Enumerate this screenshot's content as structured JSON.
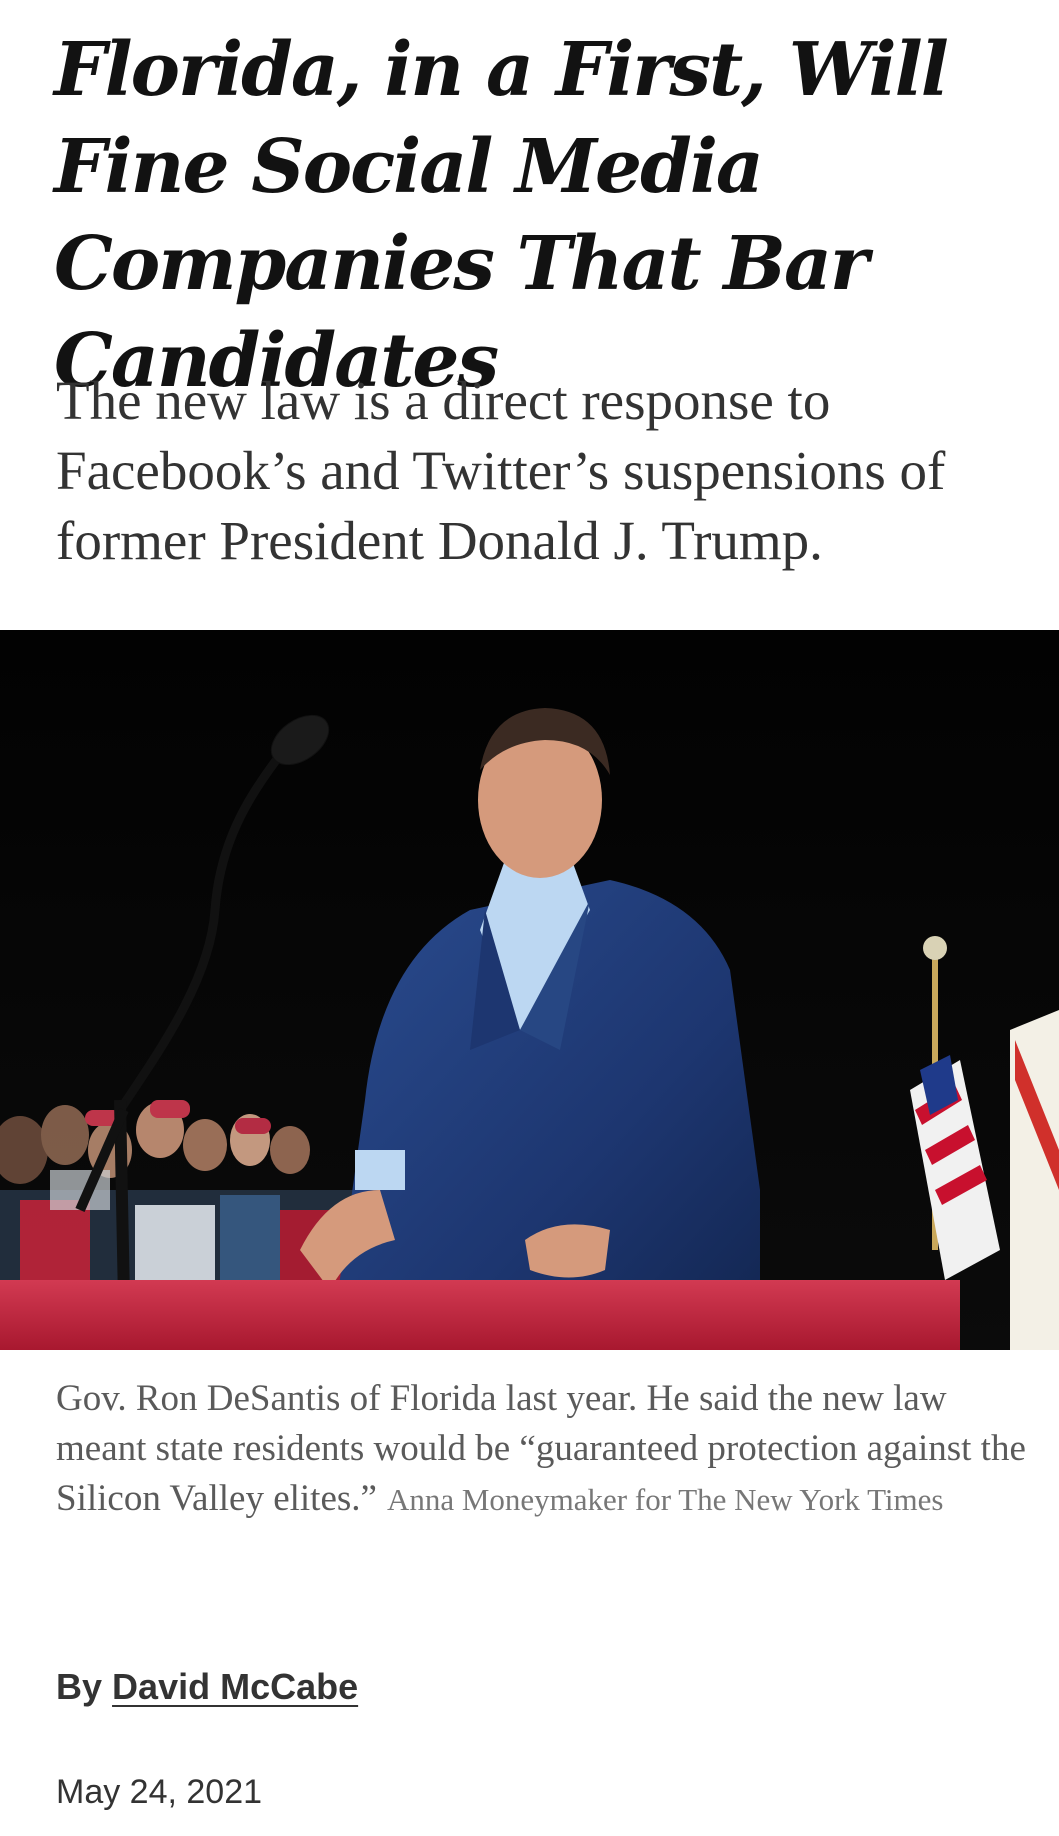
{
  "article": {
    "headline": "Florida, in a First, Will Fine Social Media Companies That Bar Candidates",
    "summary": "The new law is a direct response to Facebook’s and Twitter’s suspensions of former President Donald J. Trump.",
    "image": {
      "caption": "Gov. Ron DeSantis of Florida last year. He said the new law meant state residents would be “guaranteed protection against the Silicon Valley elites.”",
      "credit": "Anna Moneymaker for The New York Times"
    },
    "byline_prefix": "By",
    "author": "David McCabe",
    "date": "May 24, 2021"
  },
  "colors": {
    "text": "#121212",
    "caption": "#5a5a5a",
    "photo_background": "#030303",
    "podium_red": "#c4253f",
    "suit_blue": "#1f3a73"
  }
}
